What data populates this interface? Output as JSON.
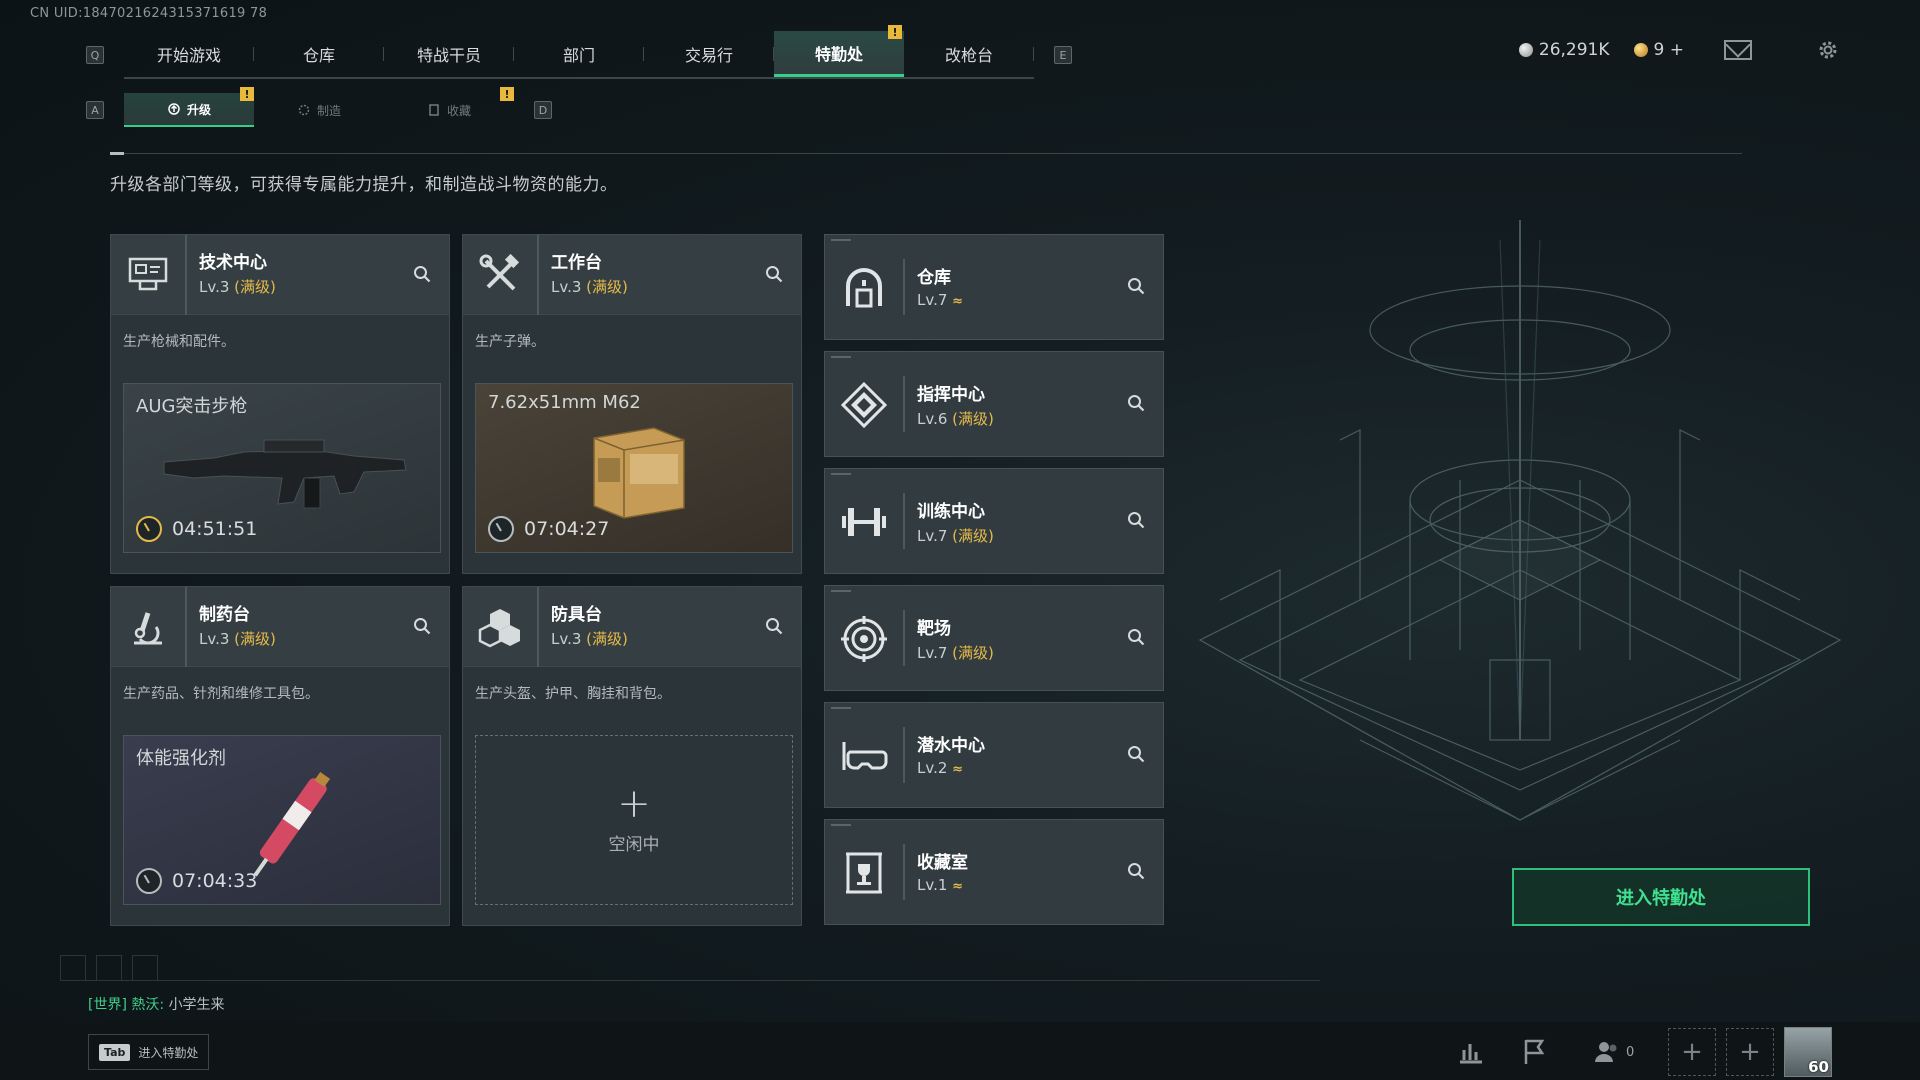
{
  "uid": "CN UID:1847021624315371619 78",
  "nav": {
    "left_key": "Q",
    "right_key": "E",
    "tabs": [
      "开始游戏",
      "仓库",
      "特战干员",
      "部门",
      "交易行",
      "特勤处",
      "改枪台"
    ],
    "active": "特勤处",
    "badge": "!"
  },
  "currency": {
    "silver": "26,291K",
    "gold": "9 +"
  },
  "subnav": {
    "left_key": "A",
    "right_key": "D",
    "tabs": [
      {
        "label": "升级",
        "active": true,
        "badge": "!"
      },
      {
        "label": "制造",
        "active": false,
        "badge": ""
      },
      {
        "label": "收藏",
        "active": false,
        "badge": "!"
      }
    ]
  },
  "description": "升级各部门等级，可获得专属能力提升，和制造战斗物资的能力。",
  "workshops": [
    {
      "title": "技术中心",
      "level": "Lv.3",
      "max": "(满级)",
      "desc": "生产枪械和配件。",
      "product": "AUG突击步枪",
      "timer": "04:51:51"
    },
    {
      "title": "工作台",
      "level": "Lv.3",
      "max": "(满级)",
      "desc": "生产子弹。",
      "product": "7.62x51mm M62",
      "timer": "07:04:27"
    },
    {
      "title": "制药台",
      "level": "Lv.3",
      "max": "(满级)",
      "desc": "生产药品、针剂和维修工具包。",
      "product": "体能强化剂",
      "timer": "07:04:33"
    },
    {
      "title": "防具台",
      "level": "Lv.3",
      "max": "(满级)",
      "desc": "生产头盔、护甲、胸挂和背包。",
      "idle": "空闲中"
    }
  ],
  "departments": [
    {
      "title": "仓库",
      "level": "Lv.7",
      "max": "",
      "upgrade": "≈"
    },
    {
      "title": "指挥中心",
      "level": "Lv.6",
      "max": "(满级)",
      "upgrade": ""
    },
    {
      "title": "训练中心",
      "level": "Lv.7",
      "max": "(满级)",
      "upgrade": ""
    },
    {
      "title": "靶场",
      "level": "Lv.7",
      "max": "(满级)",
      "upgrade": ""
    },
    {
      "title": "潜水中心",
      "level": "Lv.2",
      "max": "",
      "upgrade": "≈"
    },
    {
      "title": "收藏室",
      "level": "Lv.1",
      "max": "",
      "upgrade": "≈"
    }
  ],
  "enter_button": "进入特勤处",
  "chat": {
    "channel": "[世界]",
    "user": "熱沃:",
    "message": "小学生来"
  },
  "bottom": {
    "tab_key": "Tab",
    "tab_label": "进入特勤处",
    "friends_count": "0",
    "player_level": "60"
  },
  "colors": {
    "accent": "#33d08a",
    "max_level": "#e5b94a",
    "badge": "#e8b93a"
  }
}
